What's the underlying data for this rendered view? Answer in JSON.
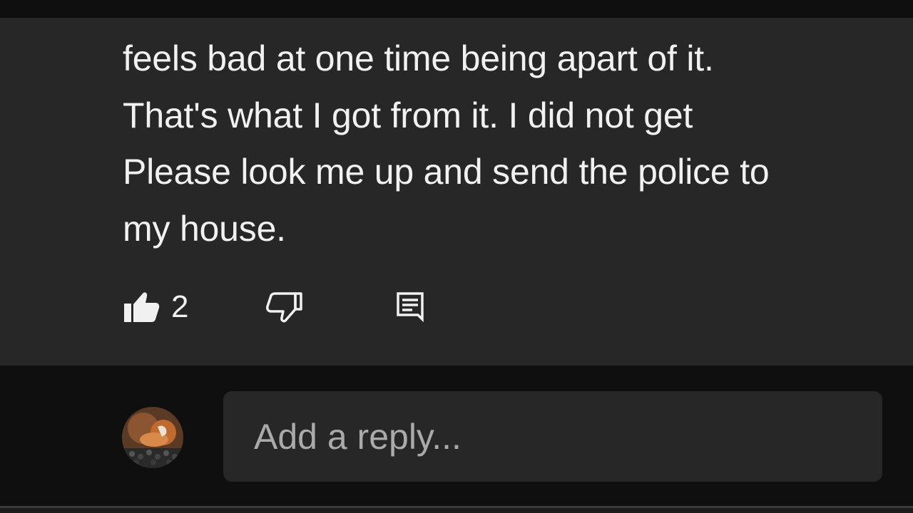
{
  "comment": {
    "lines": [
      "feels bad at one time being apart of it.",
      "That's what I got from it. I did not get",
      "Please look me up and send the police to",
      "my house."
    ]
  },
  "actions": {
    "like_icon": "thumbs-up-filled-icon",
    "like_count": "2",
    "dislike_icon": "thumbs-down-outline-icon",
    "reply_icon": "comment-reply-icon"
  },
  "reply_box": {
    "placeholder": "Add a reply...",
    "avatar_icon": "user-avatar"
  },
  "colors": {
    "panel_bg": "#272727",
    "page_bg": "#0f0f0f",
    "text": "#f1f1f1",
    "placeholder": "#aaaaaa"
  }
}
